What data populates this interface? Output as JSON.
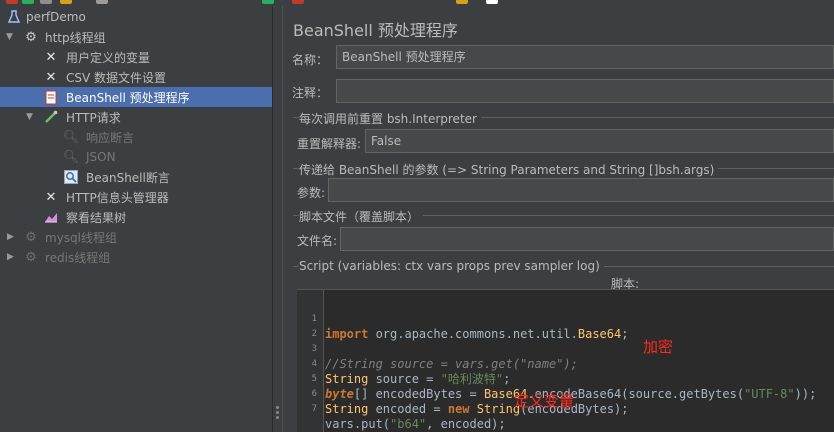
{
  "tree": {
    "items": [
      {
        "label": "perfDemo",
        "icon": "flask-icon",
        "level": 0,
        "expanded": true
      },
      {
        "label": "http线程组",
        "icon": "gear-icon",
        "level": 1,
        "expanded": true
      },
      {
        "label": "用户定义的变量",
        "icon": "wrench-icon",
        "level": 2
      },
      {
        "label": "CSV 数据文件设置",
        "icon": "wrench-icon",
        "level": 2
      },
      {
        "label": "BeanShell 预处理程序",
        "icon": "document-icon",
        "level": 2,
        "selected": true
      },
      {
        "label": "HTTP请求",
        "icon": "pipette-icon",
        "level": 2,
        "expanded": true
      },
      {
        "label": "响应断言",
        "icon": "magnifier-icon",
        "level": 3,
        "disabled": true
      },
      {
        "label": "JSON",
        "icon": "magnifier-icon",
        "level": 3,
        "disabled": true
      },
      {
        "label": "BeanShell断言",
        "icon": "magnifier-icon",
        "level": 3
      },
      {
        "label": "HTTP信息头管理器",
        "icon": "wrench-icon",
        "level": 2
      },
      {
        "label": "察看结果树",
        "icon": "chart-icon",
        "level": 2
      },
      {
        "label": "mysql线程组",
        "icon": "gear-icon",
        "level": 1,
        "disabled": true,
        "collapsed": true
      },
      {
        "label": "redis线程组",
        "icon": "gear-icon",
        "level": 1,
        "disabled": true,
        "collapsed": true
      }
    ]
  },
  "panel": {
    "title": "BeanShell 预处理程序",
    "name_label": "名称：",
    "name_value": "BeanShell 预处理程序",
    "comment_label": "注释：",
    "comment_value": "",
    "reset_group_title": "每次调用前重置 bsh.Interpreter",
    "reset_label": "重置解释器:",
    "reset_value": "False",
    "params_group_title": "传递给 BeanShell 的参数 (=> String Parameters and String []bsh.args)",
    "params_label": "参数:",
    "params_value": "",
    "file_group_title": "脚本文件（覆盖脚本）",
    "file_label": "文件名:",
    "file_value": "",
    "script_group_title": "Script (variables: ctx vars props prev sampler log)",
    "script_label": "脚本:"
  },
  "script": {
    "line_numbers": [
      "1",
      "2",
      "3",
      "4",
      "5",
      "6",
      "7"
    ]
  },
  "annotations": {
    "encrypt": "加密",
    "define_var": "定义变量"
  },
  "colors": {
    "selection": "#4b6eaf",
    "annotation": "#ff2a1a",
    "keyword": "#cc7832",
    "string": "#6a8759"
  }
}
